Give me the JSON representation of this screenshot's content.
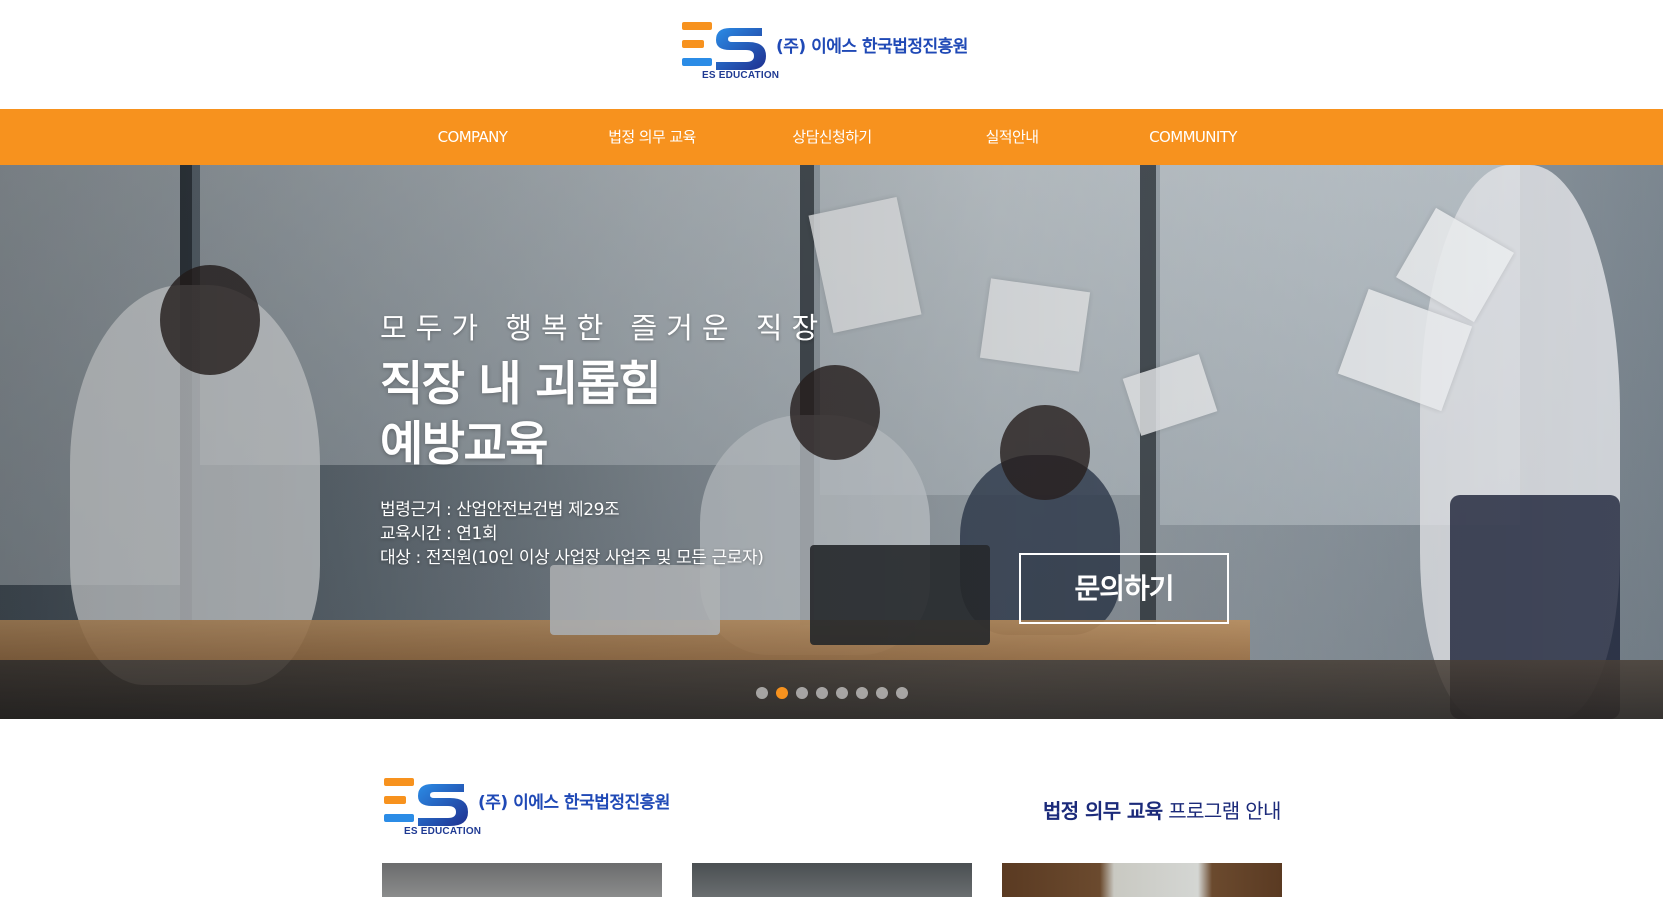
{
  "header": {
    "logo_company": "(주) 이에스 한국법정진흥원",
    "logo_sub": "ES EDUCATION"
  },
  "nav": {
    "items": [
      "COMPANY",
      "법정 의무 교육",
      "상담신청하기",
      "실적안내",
      "COMMUNITY"
    ]
  },
  "hero": {
    "subtitle": "모두가 행복한 즐거운 직장",
    "title_line1": "직장 내 괴롭힘",
    "title_line2": "예방교육",
    "info": [
      "법령근거 : 산업안전보건법 제29조",
      "교육시간 : 연1회",
      "대상 : 전직원(10인 이상 사업장 사업주 및 모든 근로자)"
    ],
    "button_label": "문의하기",
    "slides_total": 8,
    "slide_active": 2
  },
  "section": {
    "heading_strong": "법정 의무 교육",
    "heading_rest": " 프로그램 안내"
  },
  "colors": {
    "brand_orange": "#f7921e",
    "brand_blue": "#1f49b6",
    "brand_navy": "#1b2a7a"
  }
}
